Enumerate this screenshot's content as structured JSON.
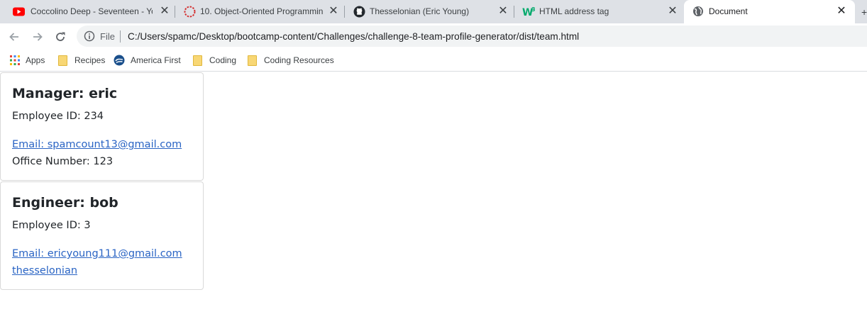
{
  "browser": {
    "tabs": [
      {
        "title": "Coccolino Deep - Seventeen - Yo",
        "icon": "youtube-icon",
        "active": false
      },
      {
        "title": "10. Object-Oriented Programmin",
        "icon": "bootcamp-spinner-icon",
        "active": false
      },
      {
        "title": "Thesselonian (Eric Young)",
        "icon": "github-icon",
        "active": false
      },
      {
        "title": "HTML address tag",
        "icon": "w3schools-icon",
        "active": false
      },
      {
        "title": "Document",
        "icon": "globe-icon",
        "active": true
      }
    ],
    "address_bar": {
      "scheme_label": "File",
      "url": "C:/Users/spamc/Desktop/bootcamp-content/Challenges/challenge-8-team-profile-generator/dist/team.html"
    },
    "bookmarks": [
      {
        "label": "Apps",
        "icon": "apps-grid-icon"
      },
      {
        "label": "Recipes",
        "icon": "folder-icon"
      },
      {
        "label": "America First",
        "icon": "america-first-icon"
      },
      {
        "label": "Coding",
        "icon": "folder-icon"
      },
      {
        "label": "Coding Resources",
        "icon": "folder-icon"
      }
    ]
  },
  "cards": [
    {
      "heading": "Manager: eric",
      "employee_id": "Employee ID: 234",
      "email_link": "Email: spamcount13@gmail.com",
      "extra": "Office Number: 123"
    },
    {
      "heading": "Engineer: bob",
      "employee_id": "Employee ID: 3",
      "email_link": "Email: ericyoung111@gmail.com",
      "github_link": "thesselonian"
    }
  ],
  "colors": {
    "tabstrip_bg": "#dee1e6",
    "link": "#2a64c4",
    "text": "#212529"
  }
}
